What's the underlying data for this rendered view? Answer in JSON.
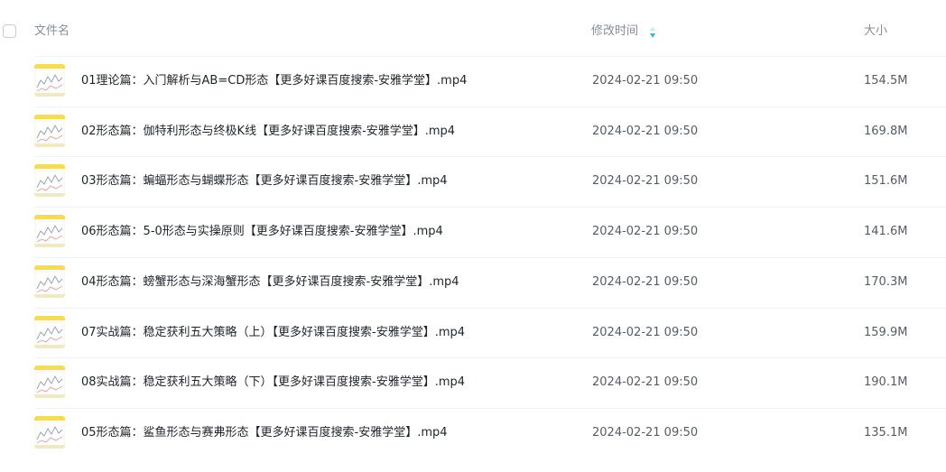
{
  "header": {
    "name_label": "文件名",
    "modified_label": "修改时间",
    "size_label": "大小",
    "sort_icon": "sort-icon"
  },
  "colors": {
    "header_text": "#878c9c",
    "sort_active": "#3fb6d8",
    "thumb_bar": "#f4dc5a"
  },
  "files": [
    {
      "name": "01理论篇：入门解析与AB=CD形态【更多好课百度搜索-安雅学堂】.mp4",
      "modified": "2024-02-21 09:50",
      "size": "154.5M"
    },
    {
      "name": "02形态篇：伽特利形态与终极K线【更多好课百度搜索-安雅学堂】.mp4",
      "modified": "2024-02-21 09:50",
      "size": "169.8M"
    },
    {
      "name": "03形态篇：蝙蝠形态与蝴蝶形态【更多好课百度搜索-安雅学堂】.mp4",
      "modified": "2024-02-21 09:50",
      "size": "151.6M"
    },
    {
      "name": "06形态篇：5-0形态与实操原则【更多好课百度搜索-安雅学堂】.mp4",
      "modified": "2024-02-21 09:50",
      "size": "141.6M"
    },
    {
      "name": "04形态篇：螃蟹形态与深海蟹形态【更多好课百度搜索-安雅学堂】.mp4",
      "modified": "2024-02-21 09:50",
      "size": "170.3M"
    },
    {
      "name": "07实战篇：稳定获利五大策略（上）【更多好课百度搜索-安雅学堂】.mp4",
      "modified": "2024-02-21 09:50",
      "size": "159.9M"
    },
    {
      "name": "08实战篇：稳定获利五大策略（下）【更多好课百度搜索-安雅学堂】.mp4",
      "modified": "2024-02-21 09:50",
      "size": "190.1M"
    },
    {
      "name": "05形态篇：鲨鱼形态与赛弗形态【更多好课百度搜索-安雅学堂】.mp4",
      "modified": "2024-02-21 09:50",
      "size": "135.1M"
    }
  ]
}
